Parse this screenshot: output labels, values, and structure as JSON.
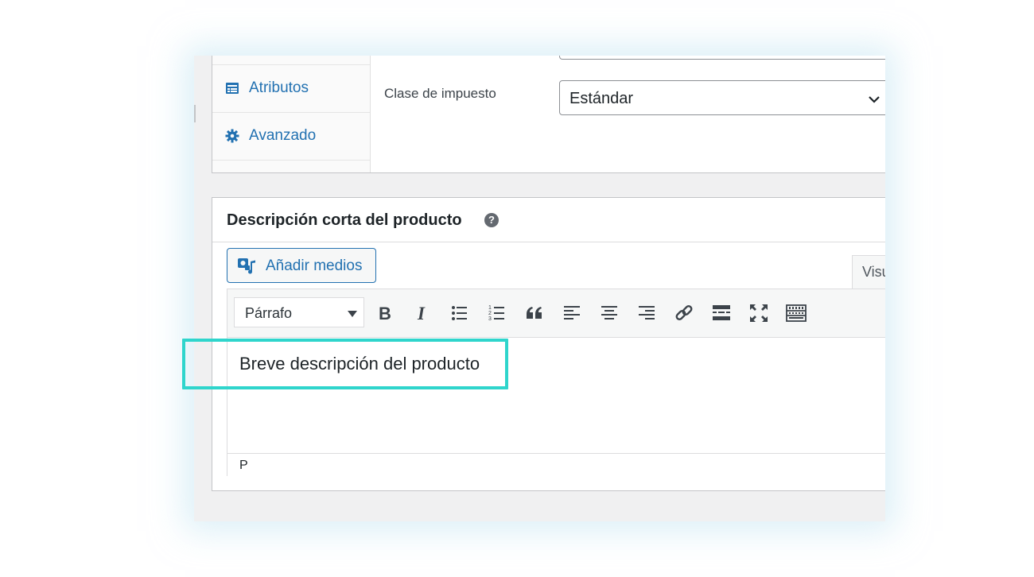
{
  "sidebar": {
    "tabs": [
      {
        "label": "Atributos",
        "icon": "attributes-icon"
      },
      {
        "label": "Avanzado",
        "icon": "gear-icon"
      }
    ]
  },
  "tax": {
    "label": "Clase de impuesto",
    "selected": "Estándar"
  },
  "short_description": {
    "title": "Descripción corta del producto",
    "help_glyph": "?",
    "add_media_label": "Añadir medios",
    "visual_tab": "Visu",
    "format_select": "Párrafo",
    "toolbar_buttons": [
      "bold",
      "italic",
      "bulleted-list",
      "numbered-list",
      "blockquote",
      "align-left",
      "align-center",
      "align-right",
      "link",
      "read-more",
      "fullscreen",
      "toolbar-toggle"
    ],
    "content": "Breve descripción del producto",
    "status_path": "P"
  },
  "colors": {
    "accent": "#2271b1",
    "highlight": "#2fd5cc"
  }
}
